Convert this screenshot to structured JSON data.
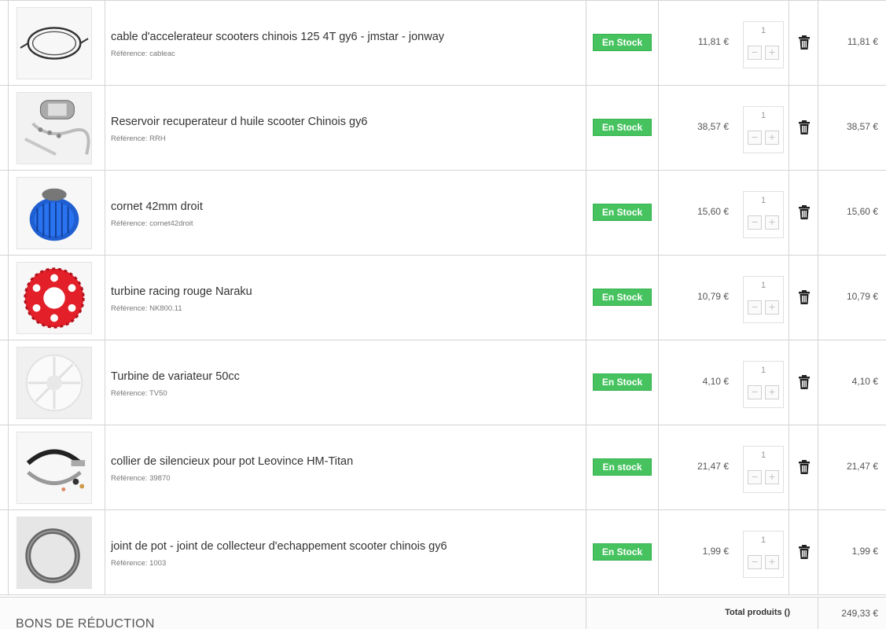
{
  "cart": {
    "rows": [
      {
        "name": "cable d'accelerateur scooters chinois 125 4T gy6 - jmstar - jonway",
        "ref": "Référence: cableac",
        "stock": "En Stock",
        "price": "11,81 €",
        "qty": "1",
        "total": "11,81 €",
        "image_icon": "cable-image"
      },
      {
        "name": "Reservoir recuperateur d huile scooter Chinois gy6",
        "ref": "Référence: RRH",
        "stock": "En Stock",
        "price": "38,57 €",
        "qty": "1",
        "total": "38,57 €",
        "image_icon": "reservoir-image"
      },
      {
        "name": "cornet 42mm droit",
        "ref": "Référence: cornet42droit",
        "stock": "En Stock",
        "price": "15,60 €",
        "qty": "1",
        "total": "15,60 €",
        "image_icon": "air-filter-image"
      },
      {
        "name": "turbine racing rouge Naraku",
        "ref": "Référence: NK800.11",
        "stock": "En Stock",
        "price": "10,79 €",
        "qty": "1",
        "total": "10,79 €",
        "image_icon": "red-turbine-image"
      },
      {
        "name": "Turbine de variateur 50cc",
        "ref": "Référence: TV50",
        "stock": "En Stock",
        "price": "4,10 €",
        "qty": "1",
        "total": "4,10 €",
        "image_icon": "white-turbine-image"
      },
      {
        "name": "collier de silencieux pour pot Leovince HM-Titan",
        "ref": "Référence: 39870",
        "stock": "En stock",
        "price": "21,47 €",
        "qty": "1",
        "total": "21,47 €",
        "image_icon": "exhaust-clamp-image"
      },
      {
        "name": "joint de pot - joint de collecteur d'echappement scooter chinois gy6",
        "ref": "Référence: 1003",
        "stock": "En Stock",
        "price": "1,99 €",
        "qty": "1",
        "total": "1,99 €",
        "image_icon": "exhaust-gasket-image"
      }
    ],
    "qty_minus_symbol": "−",
    "qty_plus_symbol": "+"
  },
  "footer": {
    "vouchers_title": "BONS DE RÉDUCTION",
    "total_products_label": "Total produits ()",
    "total_products_value": "249,33 €"
  },
  "colors": {
    "stock_badge": "#46c35f",
    "border": "#d6d4d4"
  }
}
